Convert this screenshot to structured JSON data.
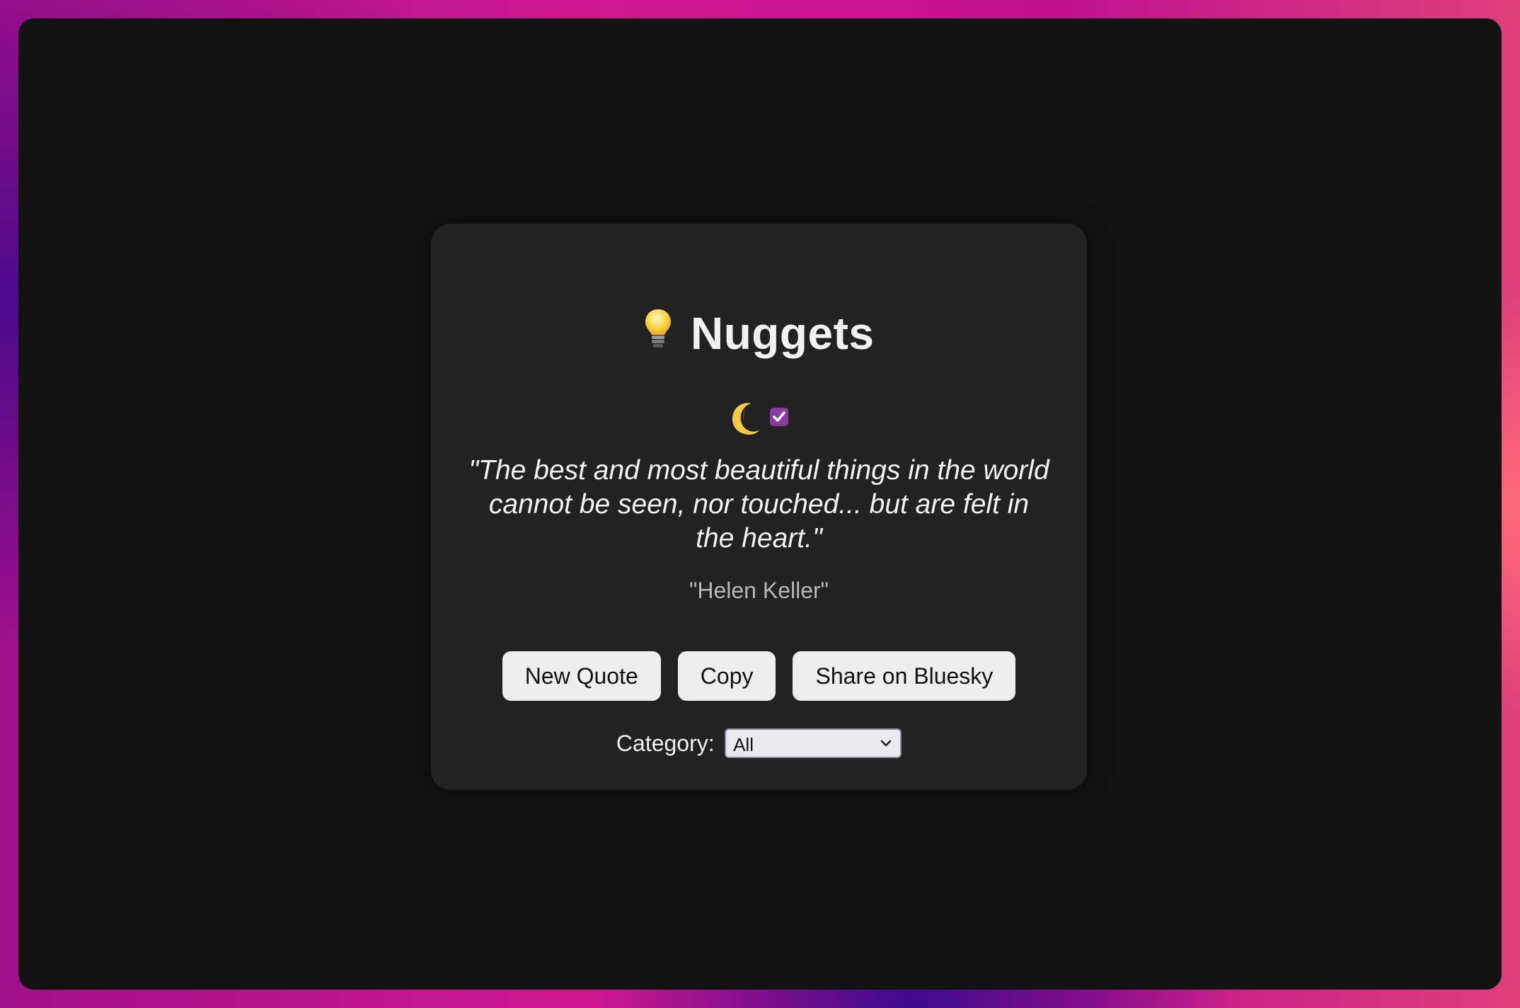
{
  "app": {
    "title": "Nuggets",
    "title_icon": "lightbulb-icon"
  },
  "theme": {
    "icon": "moon-icon",
    "dark_mode_checked": true,
    "checkbox_color": "#8a3aa0"
  },
  "quote": {
    "text": "\"The best and most beautiful things in the world cannot be seen, nor touched... but are felt in the heart.\"",
    "author": "\"Helen Keller\""
  },
  "actions": {
    "new_quote_label": "New Quote",
    "copy_label": "Copy",
    "share_label": "Share on Bluesky"
  },
  "category": {
    "label": "Category:",
    "selected": "All"
  },
  "colors": {
    "card_bg": "#222222",
    "window_bg": "#121212",
    "button_bg": "#eeeeee"
  }
}
